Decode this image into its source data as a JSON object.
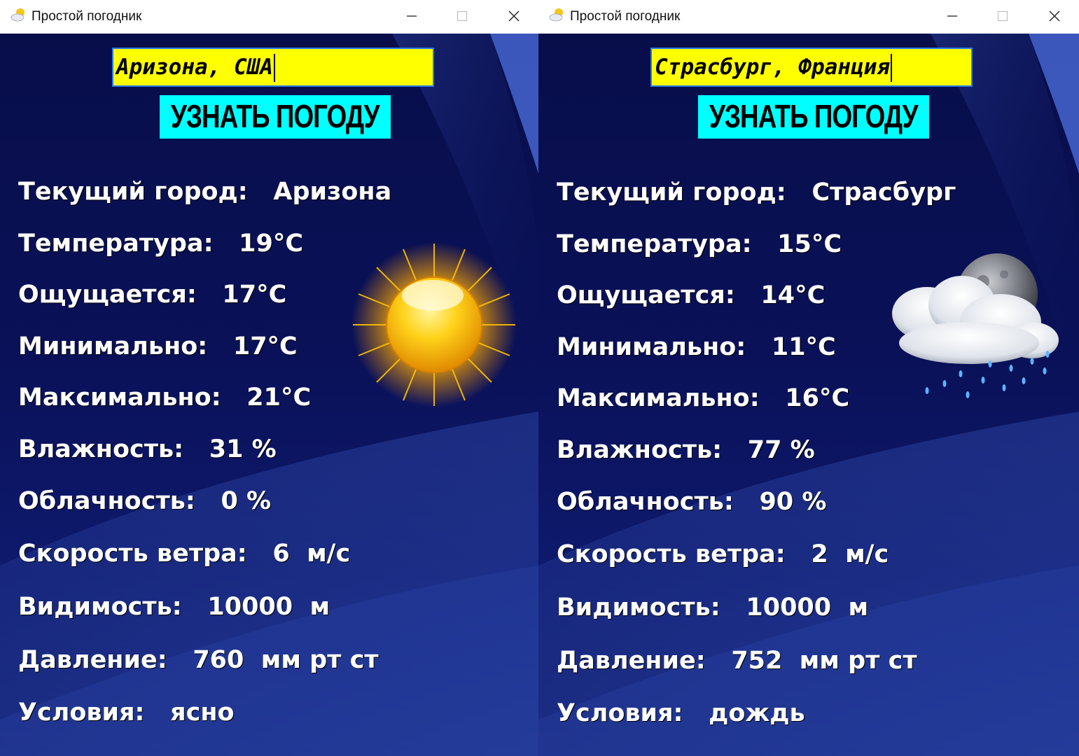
{
  "app_title": "Простой погодник",
  "button_label": "УЗНАТЬ ПОГОДУ",
  "windows": [
    {
      "city_input": "Аризона, США",
      "icon": "sun-icon",
      "rows": [
        {
          "label": "Текущий город:",
          "value": "Аризона"
        },
        {
          "label": "Температура:",
          "value": "19°C"
        },
        {
          "label": "Ощущается:",
          "value": "17°C"
        },
        {
          "label": "Минимально:",
          "value": "17°C"
        },
        {
          "label": "Максимально:",
          "value": "21°C"
        },
        {
          "label": "Влажность:",
          "value": "31 %"
        },
        {
          "label": "Облачность:",
          "value": "0 %"
        },
        {
          "label": "Скорость ветра:",
          "value": "6  м/с"
        },
        {
          "label": "Видимость:",
          "value": "10000  м"
        },
        {
          "label": "Давление:",
          "value": "760  мм рт ст"
        },
        {
          "label": "Условия:",
          "value": "ясно"
        }
      ]
    },
    {
      "city_input": "Страсбург, Франция",
      "icon": "moon-cloud-rain-icon",
      "rows": [
        {
          "label": "Текущий город:",
          "value": "Страсбург"
        },
        {
          "label": "Температура:",
          "value": "15°C"
        },
        {
          "label": "Ощущается:",
          "value": "14°C"
        },
        {
          "label": "Минимально:",
          "value": "11°C"
        },
        {
          "label": "Максимально:",
          "value": "16°C"
        },
        {
          "label": "Влажность:",
          "value": "77 %"
        },
        {
          "label": "Облачность:",
          "value": "90 %"
        },
        {
          "label": "Скорость ветра:",
          "value": "2  м/с"
        },
        {
          "label": "Видимость:",
          "value": "10000  м"
        },
        {
          "label": "Давление:",
          "value": "752  мм рт ст"
        },
        {
          "label": "Условия:",
          "value": "дождь"
        }
      ]
    }
  ]
}
